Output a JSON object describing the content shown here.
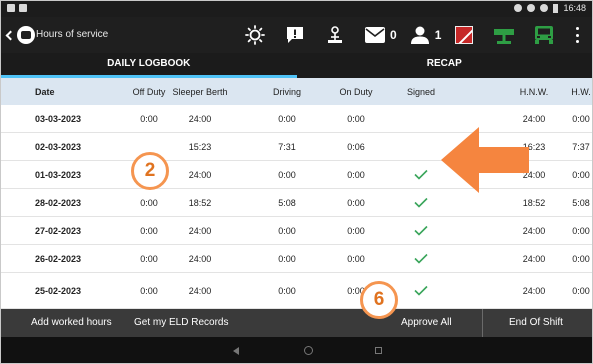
{
  "status_bar": {
    "time": "16:48"
  },
  "app_bar": {
    "title": "Hours of service",
    "message_count": "0",
    "user_count": "1",
    "icons": [
      "back-chevron-icon",
      "app-logo-icon",
      "brightness-icon",
      "alert-message-icon",
      "eld-device-icon",
      "envelope-icon",
      "user-icon",
      "flag-icon",
      "network-icon",
      "truck-icon",
      "more-menu-icon"
    ],
    "colors": {
      "accent_green": "#2e9e44",
      "flag_red": "#c62828",
      "tab_indicator": "#4fc3f7"
    }
  },
  "tabs": [
    {
      "label": "DAILY LOGBOOK",
      "active": true
    },
    {
      "label": "RECAP",
      "active": false
    }
  ],
  "table": {
    "columns": [
      "Date",
      "Off Duty",
      "Sleeper Berth",
      "Driving",
      "On Duty",
      "Signed",
      "H.N.W.",
      "H.W."
    ],
    "rows": [
      {
        "date": "03-03-2023",
        "off": "0:00",
        "sleeper": "24:00",
        "driving": "0:00",
        "on": "0:00",
        "signed": false,
        "hnw": "24:00",
        "hw": "0:00"
      },
      {
        "date": "02-03-2023",
        "off": "",
        "sleeper": "15:23",
        "driving": "7:31",
        "on": "0:06",
        "signed": false,
        "hnw": "16:23",
        "hw": "7:37"
      },
      {
        "date": "01-03-2023",
        "off": "",
        "sleeper": "24:00",
        "driving": "0:00",
        "on": "0:00",
        "signed": true,
        "hnw": "24:00",
        "hw": "0:00"
      },
      {
        "date": "28-02-2023",
        "off": "0:00",
        "sleeper": "18:52",
        "driving": "5:08",
        "on": "0:00",
        "signed": true,
        "hnw": "18:52",
        "hw": "5:08"
      },
      {
        "date": "27-02-2023",
        "off": "0:00",
        "sleeper": "24:00",
        "driving": "0:00",
        "on": "0:00",
        "signed": true,
        "hnw": "24:00",
        "hw": "0:00"
      },
      {
        "date": "26-02-2023",
        "off": "0:00",
        "sleeper": "24:00",
        "driving": "0:00",
        "on": "0:00",
        "signed": true,
        "hnw": "24:00",
        "hw": "0:00"
      },
      {
        "date": "25-02-2023",
        "off": "0:00",
        "sleeper": "24:00",
        "driving": "0:00",
        "on": "0:00",
        "signed": true,
        "hnw": "24:00",
        "hw": "0:00"
      }
    ]
  },
  "bottom_bar": {
    "add_worked_hours": "Add worked hours",
    "get_eld_records": "Get my ELD Records",
    "approve_all": "Approve All",
    "end_of_shift": "End Of Shift"
  },
  "annotations": {
    "callout_a": "2",
    "callout_b": "6",
    "arrow_color": "#f5853f"
  }
}
